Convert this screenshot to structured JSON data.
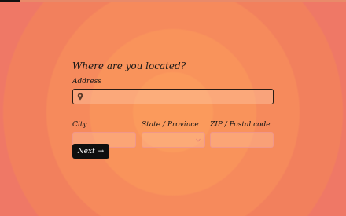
{
  "progress": {
    "fraction": 0.06
  },
  "form": {
    "question": "Where are you located?",
    "address": {
      "label": "Address",
      "value": "",
      "icon": "map-pin-icon"
    },
    "city": {
      "label": "City",
      "value": ""
    },
    "state": {
      "label": "State / Province",
      "value": "",
      "icon": "chevron-down-icon"
    },
    "zip": {
      "label": "ZIP / Postal code",
      "value": ""
    },
    "next": {
      "label": "Next",
      "icon": "arrow-right-icon",
      "glyph": "→"
    }
  },
  "colors": {
    "background": "#f68a5c",
    "button": "#0f0f0f",
    "button_text": "#ffffff"
  }
}
